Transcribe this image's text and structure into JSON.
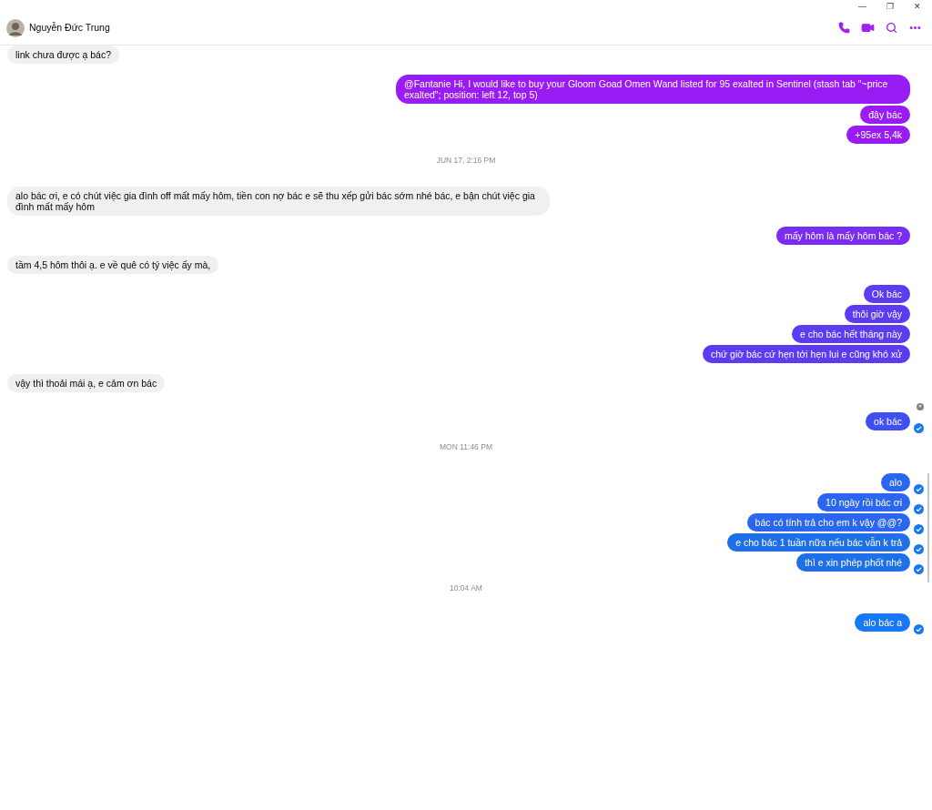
{
  "window": {
    "controls": [
      "—",
      "❐",
      "✕"
    ]
  },
  "header": {
    "contact": "Nguyễn Đức Trung"
  },
  "messages": [
    {
      "kind": "incoming",
      "text": "link chưa được ạ bác?"
    },
    {
      "kind": "outgoing",
      "text": "@Fantanie Hi, I would like to buy your Gloom Goad Omen Wand listed for 95 exalted in Sentinel (stash tab \"~price  exalted\"; position: left 12, top 5)",
      "color": "#9a1cf4",
      "receipt": false
    },
    {
      "kind": "outgoing",
      "text": "đây bác",
      "color": "#9a1cf4",
      "receipt": false
    },
    {
      "kind": "outgoing",
      "text": "+95ex 5,4k",
      "color": "#9a1cf4",
      "receipt": false
    },
    {
      "kind": "timestamp",
      "text": "JUN 17, 2:16 PM"
    },
    {
      "kind": "incoming",
      "text": "alo bác ơi, e có chút việc gia đình off mất mấy hôm, tiền con nợ bác e sẽ thu xếp gửi bác sớm nhé bác, e bận chút việc gia đình mất mấy hôm"
    },
    {
      "kind": "outgoing",
      "text": "mấy hôm là mấy hôm bác ?",
      "color": "#7b2cf2",
      "receipt": false
    },
    {
      "kind": "incoming",
      "text": "tầm 4,5 hôm thôi ạ. e về quê có tý việc ấy mà,"
    },
    {
      "kind": "outgoing",
      "text": "Ok bác",
      "color": "#5b3cf0",
      "receipt": false
    },
    {
      "kind": "outgoing",
      "text": "thôi giờ vậy",
      "color": "#5b3cf0",
      "receipt": false
    },
    {
      "kind": "outgoing",
      "text": "e cho bác hết tháng này",
      "color": "#5b3cf0",
      "receipt": false
    },
    {
      "kind": "outgoing",
      "text": "chứ giờ bác cứ hẹn tới hẹn lui e cũng khó xử",
      "color": "#5b3cf0",
      "receipt": false
    },
    {
      "kind": "incoming",
      "text": "vậy thì thoải mái ạ, e cảm ơn bác"
    },
    {
      "kind": "seen"
    },
    {
      "kind": "outgoing",
      "text": "ok bác",
      "color": "#3f4ff0",
      "receipt": true
    },
    {
      "kind": "timestamp",
      "text": "MON 11:46 PM"
    },
    {
      "kind": "outgoing",
      "text": "alo",
      "color": "#2a66ee",
      "receipt": true
    },
    {
      "kind": "outgoing",
      "text": "10 ngày rồi bác ơi",
      "color": "#2a66ee",
      "receipt": true
    },
    {
      "kind": "outgoing",
      "text": "bác có tính trả cho em k vậy @@?",
      "color": "#2a66ee",
      "receipt": true
    },
    {
      "kind": "outgoing",
      "text": "e cho bác 1 tuần nữa nếu bác vẫn k trả",
      "color": "#1f6fe8",
      "receipt": true
    },
    {
      "kind": "outgoing",
      "text": "thì e xin phép phốt nhé",
      "color": "#1f6fe8",
      "receipt": true
    },
    {
      "kind": "timestamp",
      "text": "10:04 AM"
    },
    {
      "kind": "outgoing",
      "text": "alo bác a",
      "color": "#1877f2",
      "receipt": true
    }
  ]
}
